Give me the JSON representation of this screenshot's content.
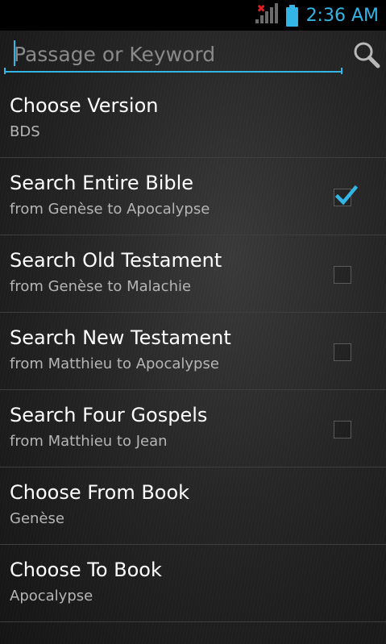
{
  "status_bar": {
    "time": "2:36 AM",
    "signal_status": "no-signal",
    "battery_level": 1.0,
    "accent_color": "#33b5e5"
  },
  "search": {
    "placeholder": "Passage or Keyword",
    "value": "",
    "button_icon": "search-icon"
  },
  "options": [
    {
      "title": "Choose Version",
      "subtitle": "BDS",
      "has_checkbox": false,
      "checked": false
    },
    {
      "title": "Search Entire Bible",
      "subtitle": "from Genèse to Apocalypse",
      "has_checkbox": true,
      "checked": true
    },
    {
      "title": "Search Old Testament",
      "subtitle": "from Genèse to Malachie",
      "has_checkbox": true,
      "checked": false
    },
    {
      "title": "Search New Testament",
      "subtitle": "from Matthieu to Apocalypse",
      "has_checkbox": true,
      "checked": false
    },
    {
      "title": "Search Four Gospels",
      "subtitle": "from Matthieu to Jean",
      "has_checkbox": true,
      "checked": false
    },
    {
      "title": "Choose From Book",
      "subtitle": "Genèse",
      "has_checkbox": false,
      "checked": false
    },
    {
      "title": "Choose To Book",
      "subtitle": "Apocalypse",
      "has_checkbox": false,
      "checked": false
    }
  ]
}
